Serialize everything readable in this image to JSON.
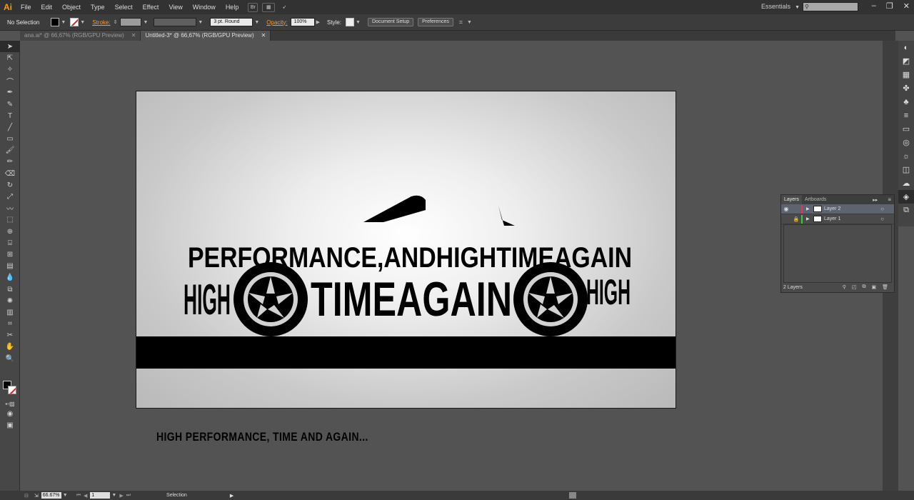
{
  "app": {
    "logo": "Ai"
  },
  "menu": [
    "File",
    "Edit",
    "Object",
    "Type",
    "Select",
    "Effect",
    "View",
    "Window",
    "Help"
  ],
  "menubar": {
    "br_label": "Br",
    "workspace": "Essentials",
    "win_min": "–",
    "win_restore": "❐",
    "win_close": "✕"
  },
  "control": {
    "selection": "No Selection",
    "stroke_label": "Stroke:",
    "brush": "3 pt. Round",
    "opacity_label": "Opacity:",
    "opacity": "100%",
    "style_label": "Style:",
    "document_setup": "Document Setup",
    "preferences": "Preferences"
  },
  "tabs": [
    {
      "label": "ana.ai* @ 66,67% (RGB/GPU Preview)"
    },
    {
      "label": "Untitled-3* @ 66,67% (RGB/GPU Preview)"
    }
  ],
  "tab_close": "✕",
  "artwork": {
    "text_top": "PERFORMANCE,ANDHIGHTIMEAGAIN",
    "text_left": "HIGH",
    "text_middle": "TIMEAGAIN",
    "text_right": "HIGH",
    "caption": "HIGH PERFORMANCE, TIME AND AGAIN..."
  },
  "layers": {
    "tab_layers": "Layers",
    "tab_artboards": "Artboards",
    "items": [
      {
        "name": "Layer 2",
        "color": "#e8325a"
      },
      {
        "name": "Layer 1",
        "color": "#3cc83c"
      }
    ],
    "count": "2 Layers"
  },
  "status": {
    "zoom": "66.67%",
    "page": "1",
    "tool": "Selection"
  },
  "colors": {
    "accent": "#f79a32",
    "layer_selected": "#5d6470"
  }
}
